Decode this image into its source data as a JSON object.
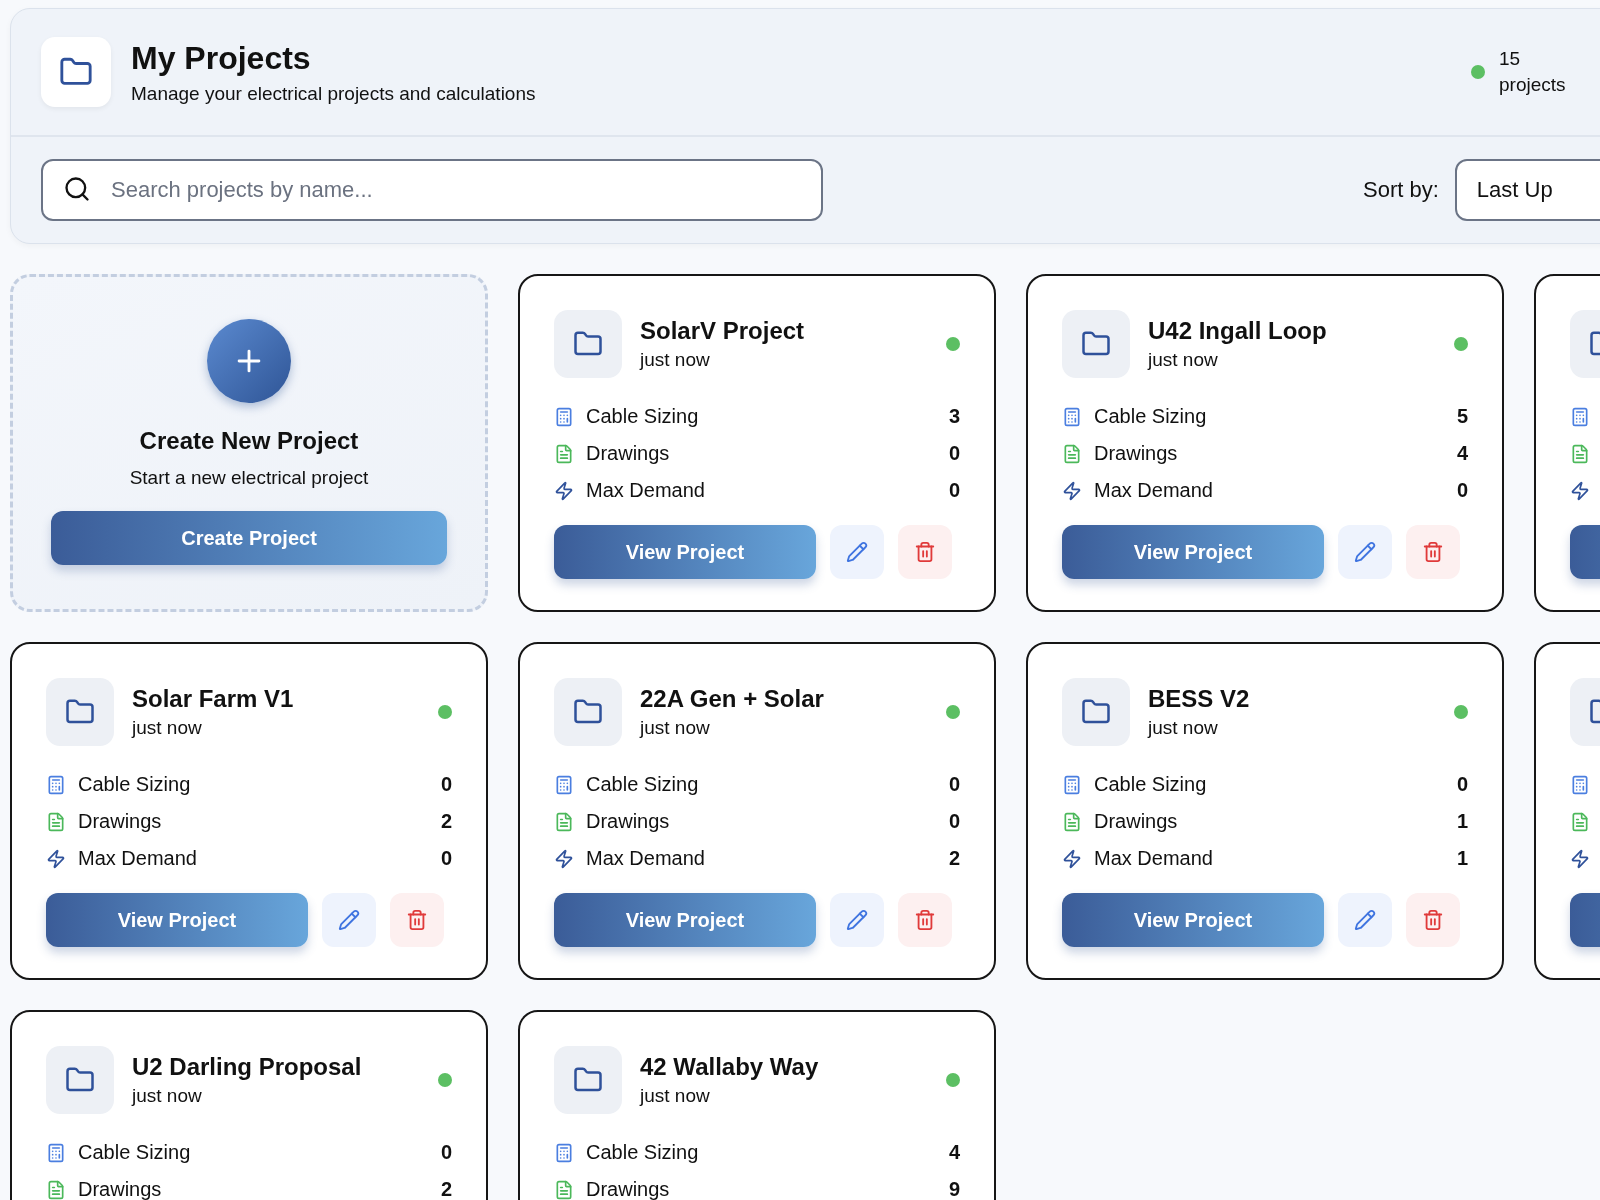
{
  "header": {
    "title": "My Projects",
    "subtitle": "Manage your electrical projects and calculations",
    "count": "15 projects"
  },
  "search": {
    "placeholder": "Search projects by name..."
  },
  "sort": {
    "label": "Sort by:",
    "value": "Last Up"
  },
  "create_card": {
    "title": "Create New Project",
    "subtitle": "Start a new electrical project",
    "button": "Create Project"
  },
  "projects": [
    {
      "kind": "full",
      "name": "SolarV Project",
      "time": "just now",
      "stats": [
        {
          "kind": "cable",
          "label": "Cable Sizing",
          "value": "3"
        },
        {
          "kind": "drawings",
          "label": "Drawings",
          "value": "0"
        },
        {
          "kind": "demand",
          "label": "Max Demand",
          "value": "0"
        }
      ],
      "view_label": "View Project"
    },
    {
      "kind": "full",
      "name": "U42 Ingall Loop",
      "time": "just now",
      "stats": [
        {
          "kind": "cable",
          "label": "Cable Sizing",
          "value": "5"
        },
        {
          "kind": "drawings",
          "label": "Drawings",
          "value": "4"
        },
        {
          "kind": "demand",
          "label": "Max Demand",
          "value": "0"
        }
      ],
      "view_label": "View Project"
    },
    {
      "kind": "cut",
      "stats": [
        {
          "kind": "cable"
        },
        {
          "kind": "drawings"
        },
        {
          "kind": "demand"
        }
      ]
    },
    {
      "kind": "full",
      "name": "Solar Farm V1",
      "time": "just now",
      "stats": [
        {
          "kind": "cable",
          "label": "Cable Sizing",
          "value": "0"
        },
        {
          "kind": "drawings",
          "label": "Drawings",
          "value": "2"
        },
        {
          "kind": "demand",
          "label": "Max Demand",
          "value": "0"
        }
      ],
      "view_label": "View Project"
    },
    {
      "kind": "full",
      "name": "22A Gen + Solar",
      "time": "just now",
      "stats": [
        {
          "kind": "cable",
          "label": "Cable Sizing",
          "value": "0"
        },
        {
          "kind": "drawings",
          "label": "Drawings",
          "value": "0"
        },
        {
          "kind": "demand",
          "label": "Max Demand",
          "value": "2"
        }
      ],
      "view_label": "View Project"
    },
    {
      "kind": "full",
      "name": "BESS V2",
      "time": "just now",
      "stats": [
        {
          "kind": "cable",
          "label": "Cable Sizing",
          "value": "0"
        },
        {
          "kind": "drawings",
          "label": "Drawings",
          "value": "1"
        },
        {
          "kind": "demand",
          "label": "Max Demand",
          "value": "1"
        }
      ],
      "view_label": "View Project"
    },
    {
      "kind": "cut",
      "stats": [
        {
          "kind": "cable"
        },
        {
          "kind": "drawings"
        },
        {
          "kind": "demand"
        }
      ]
    },
    {
      "kind": "full",
      "name": "U2 Darling Proposal",
      "time": "just now",
      "stats": [
        {
          "kind": "cable",
          "label": "Cable Sizing",
          "value": "0"
        },
        {
          "kind": "drawings",
          "label": "Drawings",
          "value": "2"
        }
      ]
    },
    {
      "kind": "full",
      "name": "42 Wallaby Way",
      "time": "just now",
      "stats": [
        {
          "kind": "cable",
          "label": "Cable Sizing",
          "value": "4"
        },
        {
          "kind": "drawings",
          "label": "Drawings",
          "value": "9"
        }
      ]
    }
  ]
}
